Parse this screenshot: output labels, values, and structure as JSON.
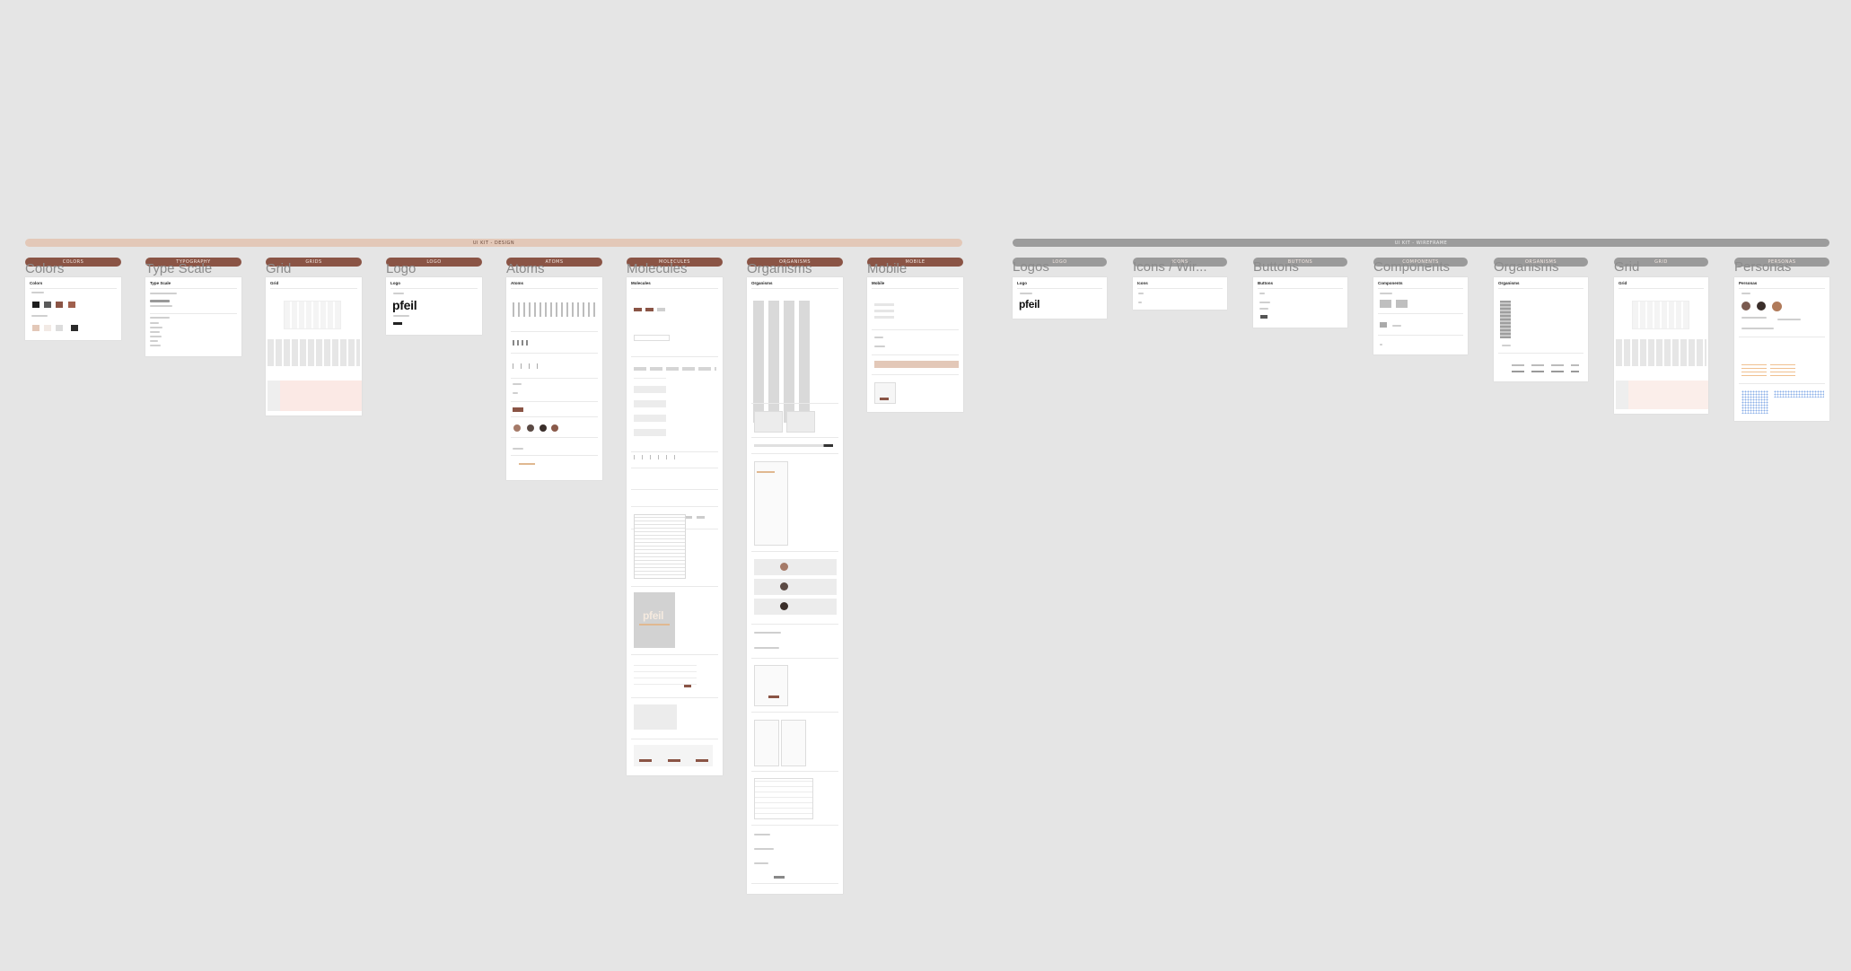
{
  "groups": [
    {
      "label": "UI KIT - DESIGN",
      "color": "#e3c8b8",
      "text_color": "#6b4a3c"
    },
    {
      "label": "UI KIT - WIREFRAME",
      "color": "#9c9c9c",
      "text_color": "#eeeeee"
    }
  ],
  "design": [
    {
      "pill": "COLORS",
      "title": "Colors",
      "heading": "Colors"
    },
    {
      "pill": "TYPOGRAPHY",
      "title": "Type Scale",
      "heading": "Type Scale"
    },
    {
      "pill": "GRIDS",
      "title": "Grid",
      "heading": "Grid"
    },
    {
      "pill": "LOGO",
      "title": "Logo",
      "heading": "Logo",
      "logo_text": "pfeil"
    },
    {
      "pill": "ATOMS",
      "title": "Atoms",
      "heading": "Atoms"
    },
    {
      "pill": "MOLECULES",
      "title": "Molecules",
      "heading": "Molecules",
      "logo_text": "pfeil"
    },
    {
      "pill": "ORGANISMS",
      "title": "Organisms",
      "heading": "Organisms"
    },
    {
      "pill": "MOBILE",
      "title": "Mobile",
      "heading": "Mobile"
    }
  ],
  "wireframe": [
    {
      "pill": "LOGO",
      "title": "Logos",
      "heading": "Logo",
      "logo_text": "pfeil"
    },
    {
      "pill": "ICONS",
      "title": "Icons / Wir...",
      "heading": "Icons"
    },
    {
      "pill": "BUTTONS",
      "title": "Buttons",
      "heading": "Buttons"
    },
    {
      "pill": "COMPONENTS",
      "title": "Components",
      "heading": "Components"
    },
    {
      "pill": "ORGANISMS",
      "title": "Organisms",
      "heading": "Organisms"
    },
    {
      "pill": "GRID",
      "title": "Grid",
      "heading": "Grid"
    },
    {
      "pill": "PERSONAS",
      "title": "Personas",
      "heading": "Personas"
    }
  ],
  "colors": {
    "canvas": "#e5e5e5",
    "design_pill": "#8a5445",
    "wireframe_pill": "#9a9a9a",
    "frame_title": "#8c8c8c"
  }
}
